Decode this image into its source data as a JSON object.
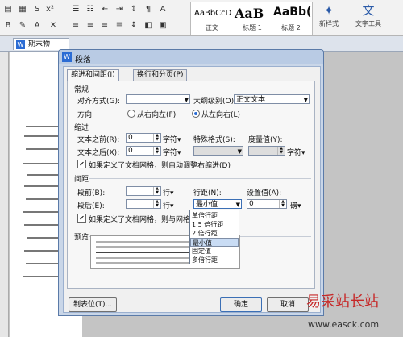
{
  "ribbon": {
    "styles": [
      {
        "preview": "AaBbCcD",
        "label": "正文"
      },
      {
        "preview": "AaB",
        "label": "标题 1"
      },
      {
        "preview": "AaBb(",
        "label": "标题 2"
      }
    ],
    "new_style_label": "新样式",
    "text_tools_label": "文字工具"
  },
  "doc_tab": {
    "label": "期末物"
  },
  "dialog": {
    "title": "段落",
    "tabs": [
      "缩进和间距(I)",
      "换行和分页(P)"
    ],
    "sections": {
      "general": "常规",
      "indent": "缩进",
      "spacing": "间距",
      "preview": "预览"
    },
    "general": {
      "align_label": "对齐方式(G):",
      "align_value": "",
      "outline_label": "大纲级别(O):",
      "outline_value": "正文文本",
      "direction_label": "方向:",
      "rtl_label": "从右向左(F)",
      "ltr_label": "从左向右(L)"
    },
    "indent": {
      "before_label": "文本之前(R):",
      "before_value": "0",
      "after_label": "文本之后(X):",
      "after_value": "0",
      "unit": "字符▾",
      "special_label": "特殊格式(S):",
      "special_value": "",
      "measure_label": "度量值(Y):",
      "measure_unit": "字符▾",
      "grid_check": "如果定义了文档网格，则自动调整右缩进(D)"
    },
    "spacing": {
      "before_label": "段前(B):",
      "after_label": "段后(E):",
      "unit": "行▾",
      "line_label": "行距(N):",
      "line_value": "最小值",
      "set_label": "设置值(A):",
      "set_value": "0",
      "set_unit": "磅▾",
      "grid_check": "如果定义了文档网格，则与网格对"
    },
    "line_options": [
      "单倍行距",
      "1.5 倍行距",
      "2 倍行距",
      "最小值",
      "固定值",
      "多倍行距"
    ],
    "buttons": {
      "tabs": "制表位(T)...",
      "ok": "确定",
      "cancel": "取消"
    }
  },
  "watermark": {
    "text": "易采站长站",
    "url": "www.easck.com"
  }
}
